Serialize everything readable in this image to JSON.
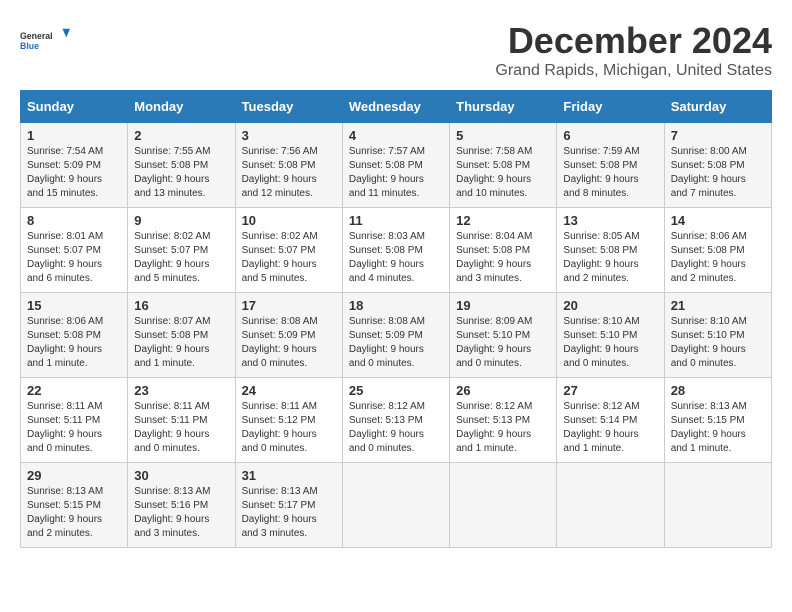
{
  "logo": {
    "line1": "General",
    "line2": "Blue"
  },
  "title": "December 2024",
  "subtitle": "Grand Rapids, Michigan, United States",
  "headers": [
    "Sunday",
    "Monday",
    "Tuesday",
    "Wednesday",
    "Thursday",
    "Friday",
    "Saturday"
  ],
  "weeks": [
    [
      {
        "day": "1",
        "sunrise": "7:54 AM",
        "sunset": "5:09 PM",
        "daylight": "9 hours and 15 minutes."
      },
      {
        "day": "2",
        "sunrise": "7:55 AM",
        "sunset": "5:08 PM",
        "daylight": "9 hours and 13 minutes."
      },
      {
        "day": "3",
        "sunrise": "7:56 AM",
        "sunset": "5:08 PM",
        "daylight": "9 hours and 12 minutes."
      },
      {
        "day": "4",
        "sunrise": "7:57 AM",
        "sunset": "5:08 PM",
        "daylight": "9 hours and 11 minutes."
      },
      {
        "day": "5",
        "sunrise": "7:58 AM",
        "sunset": "5:08 PM",
        "daylight": "9 hours and 10 minutes."
      },
      {
        "day": "6",
        "sunrise": "7:59 AM",
        "sunset": "5:08 PM",
        "daylight": "9 hours and 8 minutes."
      },
      {
        "day": "7",
        "sunrise": "8:00 AM",
        "sunset": "5:08 PM",
        "daylight": "9 hours and 7 minutes."
      }
    ],
    [
      {
        "day": "8",
        "sunrise": "8:01 AM",
        "sunset": "5:07 PM",
        "daylight": "9 hours and 6 minutes."
      },
      {
        "day": "9",
        "sunrise": "8:02 AM",
        "sunset": "5:07 PM",
        "daylight": "9 hours and 5 minutes."
      },
      {
        "day": "10",
        "sunrise": "8:02 AM",
        "sunset": "5:07 PM",
        "daylight": "9 hours and 5 minutes."
      },
      {
        "day": "11",
        "sunrise": "8:03 AM",
        "sunset": "5:08 PM",
        "daylight": "9 hours and 4 minutes."
      },
      {
        "day": "12",
        "sunrise": "8:04 AM",
        "sunset": "5:08 PM",
        "daylight": "9 hours and 3 minutes."
      },
      {
        "day": "13",
        "sunrise": "8:05 AM",
        "sunset": "5:08 PM",
        "daylight": "9 hours and 2 minutes."
      },
      {
        "day": "14",
        "sunrise": "8:06 AM",
        "sunset": "5:08 PM",
        "daylight": "9 hours and 2 minutes."
      }
    ],
    [
      {
        "day": "15",
        "sunrise": "8:06 AM",
        "sunset": "5:08 PM",
        "daylight": "9 hours and 1 minute."
      },
      {
        "day": "16",
        "sunrise": "8:07 AM",
        "sunset": "5:08 PM",
        "daylight": "9 hours and 1 minute."
      },
      {
        "day": "17",
        "sunrise": "8:08 AM",
        "sunset": "5:09 PM",
        "daylight": "9 hours and 0 minutes."
      },
      {
        "day": "18",
        "sunrise": "8:08 AM",
        "sunset": "5:09 PM",
        "daylight": "9 hours and 0 minutes."
      },
      {
        "day": "19",
        "sunrise": "8:09 AM",
        "sunset": "5:10 PM",
        "daylight": "9 hours and 0 minutes."
      },
      {
        "day": "20",
        "sunrise": "8:10 AM",
        "sunset": "5:10 PM",
        "daylight": "9 hours and 0 minutes."
      },
      {
        "day": "21",
        "sunrise": "8:10 AM",
        "sunset": "5:10 PM",
        "daylight": "9 hours and 0 minutes."
      }
    ],
    [
      {
        "day": "22",
        "sunrise": "8:11 AM",
        "sunset": "5:11 PM",
        "daylight": "9 hours and 0 minutes."
      },
      {
        "day": "23",
        "sunrise": "8:11 AM",
        "sunset": "5:11 PM",
        "daylight": "9 hours and 0 minutes."
      },
      {
        "day": "24",
        "sunrise": "8:11 AM",
        "sunset": "5:12 PM",
        "daylight": "9 hours and 0 minutes."
      },
      {
        "day": "25",
        "sunrise": "8:12 AM",
        "sunset": "5:13 PM",
        "daylight": "9 hours and 0 minutes."
      },
      {
        "day": "26",
        "sunrise": "8:12 AM",
        "sunset": "5:13 PM",
        "daylight": "9 hours and 1 minute."
      },
      {
        "day": "27",
        "sunrise": "8:12 AM",
        "sunset": "5:14 PM",
        "daylight": "9 hours and 1 minute."
      },
      {
        "day": "28",
        "sunrise": "8:13 AM",
        "sunset": "5:15 PM",
        "daylight": "9 hours and 1 minute."
      }
    ],
    [
      {
        "day": "29",
        "sunrise": "8:13 AM",
        "sunset": "5:15 PM",
        "daylight": "9 hours and 2 minutes."
      },
      {
        "day": "30",
        "sunrise": "8:13 AM",
        "sunset": "5:16 PM",
        "daylight": "9 hours and 3 minutes."
      },
      {
        "day": "31",
        "sunrise": "8:13 AM",
        "sunset": "5:17 PM",
        "daylight": "9 hours and 3 minutes."
      },
      null,
      null,
      null,
      null
    ]
  ]
}
